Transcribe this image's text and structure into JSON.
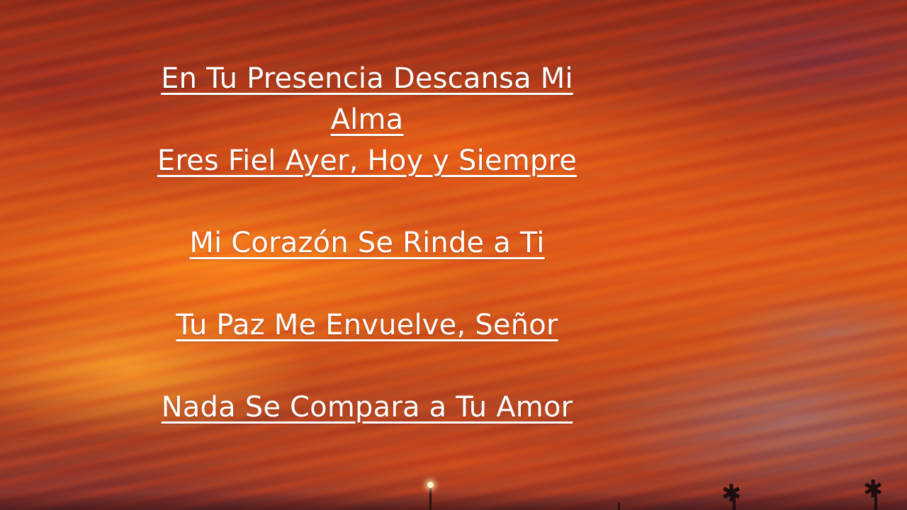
{
  "background": {
    "description_icon": "sunset-clouds-photo",
    "colors": {
      "sky_dark": "#8a2f1e",
      "sky_orange": "#d9621e",
      "text": "#ffffff"
    }
  },
  "lyrics": {
    "lines": [
      "En Tu Presencia Descansa Mi Alma",
      "Eres Fiel Ayer, Hoy y Siempre",
      "Mi Corazón Se Rinde a Ti",
      "Tu Paz Me Envuelve, Señor",
      "Nada Se Compara a Tu Amor"
    ]
  }
}
